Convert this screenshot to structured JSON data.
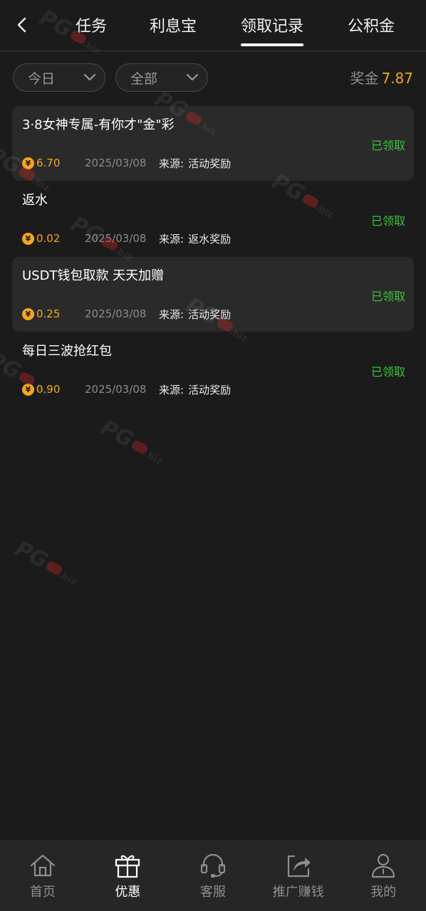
{
  "header": {
    "tabs": [
      {
        "label": "任务",
        "active": false
      },
      {
        "label": "利息宝",
        "active": false
      },
      {
        "label": "领取记录",
        "active": true
      },
      {
        "label": "公积金",
        "active": false
      }
    ]
  },
  "filters": {
    "date_selected": "今日",
    "type_selected": "全部"
  },
  "bonus": {
    "label": "奖金",
    "value": "7.87"
  },
  "records": [
    {
      "title": "3·8女神专属-有你才\"金\"彩",
      "status": "已领取",
      "amount": "6.70",
      "date": "2025/03/08",
      "source_label": "来源:",
      "source": "活动奖励",
      "shaded": true
    },
    {
      "title": "返水",
      "status": "已领取",
      "amount": "0.02",
      "date": "2025/03/08",
      "source_label": "来源:",
      "source": "返水奖励",
      "shaded": false
    },
    {
      "title": "USDT钱包取款 天天加赠",
      "status": "已领取",
      "amount": "0.25",
      "date": "2025/03/08",
      "source_label": "来源:",
      "source": "活动奖励",
      "shaded": true
    },
    {
      "title": "每日三波抢红包",
      "status": "已领取",
      "amount": "0.90",
      "date": "2025/03/08",
      "source_label": "来源:",
      "source": "活动奖励",
      "shaded": false
    }
  ],
  "watermark": {
    "brand": "PG",
    "suffix": ".biz"
  },
  "bottom_nav": [
    {
      "label": "首页",
      "icon": "home-icon",
      "active": false
    },
    {
      "label": "优惠",
      "icon": "gift-icon",
      "active": true
    },
    {
      "label": "客服",
      "icon": "headset-icon",
      "active": false
    },
    {
      "label": "推广赚钱",
      "icon": "share-icon",
      "active": false
    },
    {
      "label": "我的",
      "icon": "user-icon",
      "active": false
    }
  ],
  "colors": {
    "background": "#1b1b1b",
    "card": "#2a2a2a",
    "accent_gold": "#f5a623",
    "status_green": "#38c53a",
    "nav_background": "#262626"
  }
}
